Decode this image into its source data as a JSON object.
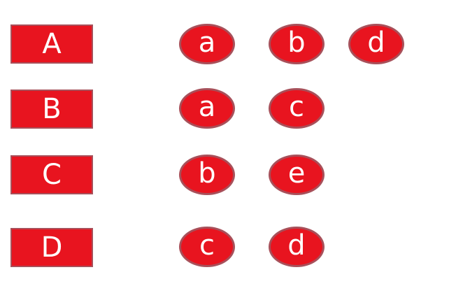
{
  "rows": [
    {
      "label": "A",
      "items": [
        "a",
        "b",
        "d"
      ]
    },
    {
      "label": "B",
      "items": [
        "a",
        "c"
      ]
    },
    {
      "label": "C",
      "items": [
        "b",
        "e"
      ]
    },
    {
      "label": "D",
      "items": [
        "c",
        "d"
      ]
    }
  ],
  "colors": {
    "fill": "#e8141f",
    "border": "#a8505a",
    "text": "#ffffff"
  }
}
